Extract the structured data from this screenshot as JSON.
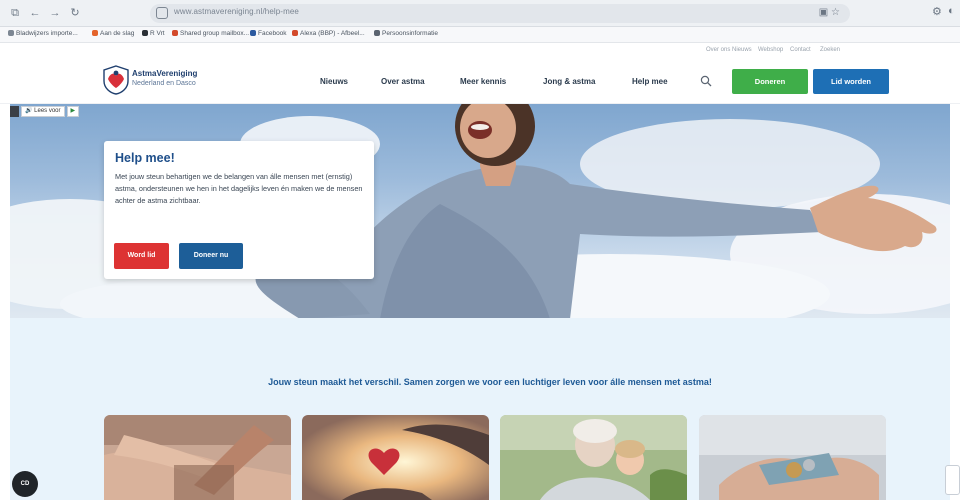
{
  "browser": {
    "url": "www.astmavereniging.nl/help-mee",
    "bookmarks": [
      "Bladwijzers importe...",
      "Aan de slag",
      "R Vrt",
      "Shared group mailbox...",
      "Facebook",
      "Alexa (BBP) - Afbeel...",
      "Persoonsinformatie"
    ]
  },
  "utility_links": [
    "Over ons",
    "Nieuws",
    "Webshop",
    "Contact",
    "Zoeken"
  ],
  "logo": {
    "line1": "AstmaVereniging",
    "line2": "Nederland en Dasco"
  },
  "nav": {
    "items": [
      "Nieuws",
      "Over astma",
      "Meer kennis",
      "Jong & astma",
      "Help mee"
    ],
    "donate_label": "Doneren",
    "member_label": "Lid worden"
  },
  "readaloud": {
    "label": "Lees voor"
  },
  "hero": {
    "title": "Help mee!",
    "text": "Met jouw steun behartigen we de belangen van álle mensen met (ernstig) astma, ondersteunen we hen in het dagelijks leven én maken we de mensen achter de astma zichtbaar.",
    "btn_member": "Word lid",
    "btn_donate": "Doneer nu"
  },
  "tagline": "Jouw steun maakt het verschil. Samen zorgen we voor een luchtiger leven voor álle mensen met astma!",
  "chat": {
    "label": "CD"
  },
  "colors": {
    "green": "#3fae49",
    "blue": "#1e6fb5",
    "red": "#dd3333",
    "navy": "#1d5e98",
    "tagline": "#1e5a96"
  }
}
